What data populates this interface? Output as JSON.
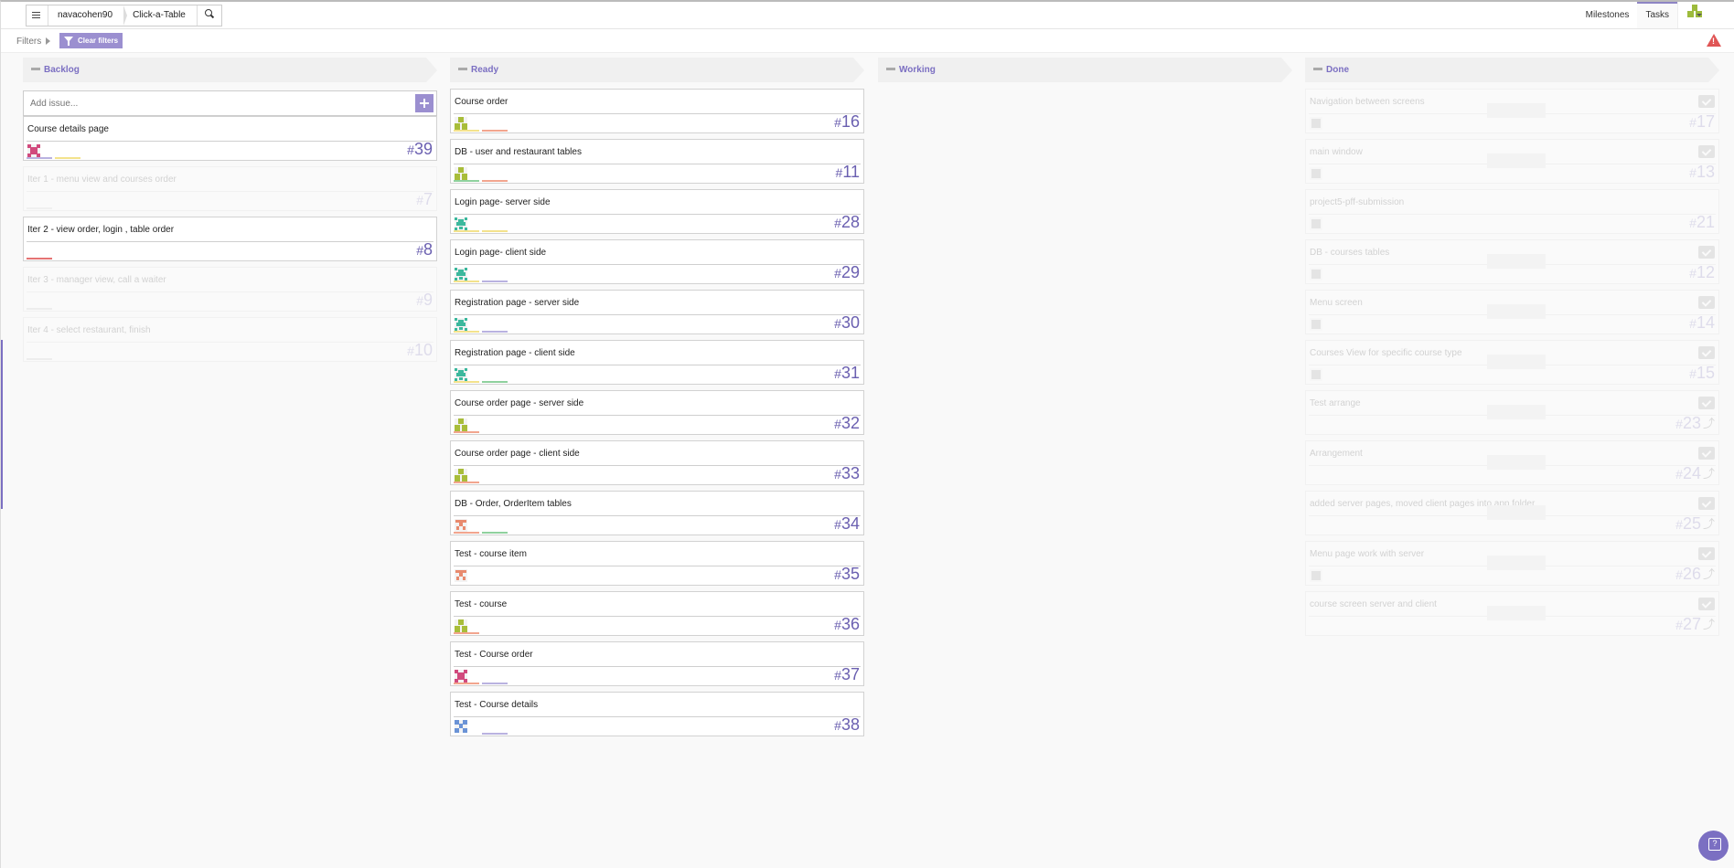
{
  "breadcrumb": {
    "owner": "navacohen90",
    "repo": "Click-a-Table"
  },
  "topnav": {
    "milestones": "Milestones",
    "tasks": "Tasks"
  },
  "filters": {
    "label": "Filters",
    "clear": "Clear filters"
  },
  "colors": {
    "accent": "#7b6fc2",
    "button": "#9b8fd0",
    "warning": "#e05555"
  },
  "columns": [
    {
      "title": "Backlog",
      "add_issue_placeholder": "Add issue...",
      "cards": [
        {
          "title": "Course details page",
          "hash": "#",
          "number": "39",
          "faded": false,
          "avatar": "pink",
          "bars": [
            "#b9b2e0",
            "#f3e28c"
          ]
        },
        {
          "title": "Iter 1 - menu view and courses order",
          "hash": "#",
          "number": "7",
          "faded": true,
          "avatar": "",
          "bars": [
            "#cccccc"
          ]
        },
        {
          "title": "Iter 2 - view order, login , table order",
          "hash": "#",
          "number": "8",
          "faded": false,
          "avatar": "",
          "bars": [
            "#e57373"
          ]
        },
        {
          "title": "Iter 3 - manager view, call a waiter",
          "hash": "#",
          "number": "9",
          "faded": true,
          "avatar": "",
          "bars": [
            "#bbbbbb"
          ]
        },
        {
          "title": "Iter 4 - select restaurant, finish",
          "hash": "#",
          "number": "10",
          "faded": true,
          "avatar": "",
          "bars": [
            "#bbbbbb"
          ]
        }
      ]
    },
    {
      "title": "Ready",
      "cards": [
        {
          "title": "Course order",
          "hash": "#",
          "number": "16",
          "faded": false,
          "avatar": "olive",
          "bars": [
            "#f3e28c",
            "#f2a58e"
          ]
        },
        {
          "title": "DB - user and restaurant tables",
          "hash": "#",
          "number": "11",
          "faded": false,
          "avatar": "olive",
          "bars": [
            "#8fd19e",
            "#f2a58e"
          ]
        },
        {
          "title": "Login page- server side",
          "hash": "#",
          "number": "28",
          "faded": false,
          "avatar": "teal",
          "bars": [
            "#f3e28c",
            "#f3e28c"
          ]
        },
        {
          "title": "Login page- client side",
          "hash": "#",
          "number": "29",
          "faded": false,
          "avatar": "teal",
          "bars": [
            "#f3e28c",
            "#b9b2e0"
          ]
        },
        {
          "title": "Registration page - server side",
          "hash": "#",
          "number": "30",
          "faded": false,
          "avatar": "teal",
          "bars": [
            "#f3e28c",
            "#b9b2e0"
          ]
        },
        {
          "title": "Registration page - client side",
          "hash": "#",
          "number": "31",
          "faded": false,
          "avatar": "teal",
          "bars": [
            "#f3e28c",
            "#8fd19e"
          ]
        },
        {
          "title": "Course order page - server side",
          "hash": "#",
          "number": "32",
          "faded": false,
          "avatar": "olive",
          "bars": [
            "#f2a58e"
          ]
        },
        {
          "title": "Course order page - client side",
          "hash": "#",
          "number": "33",
          "faded": false,
          "avatar": "olive",
          "bars": [
            "#f2a58e"
          ]
        },
        {
          "title": "DB - Order, OrderItem tables",
          "hash": "#",
          "number": "34",
          "faded": false,
          "avatar": "salmon",
          "bars": [
            "#f2a58e",
            "#8fd19e"
          ]
        },
        {
          "title": "Test - course item",
          "hash": "#",
          "number": "35",
          "faded": false,
          "avatar": "salmon",
          "bars": []
        },
        {
          "title": "Test - course",
          "hash": "#",
          "number": "36",
          "faded": false,
          "avatar": "olive",
          "bars": [
            "#f2a58e"
          ]
        },
        {
          "title": "Test - Course order",
          "hash": "#",
          "number": "37",
          "faded": false,
          "avatar": "pink",
          "bars": [
            "#f2a58e",
            "#b9b2e0"
          ]
        },
        {
          "title": "Test - Course details",
          "hash": "#",
          "number": "38",
          "faded": false,
          "avatar": "blue",
          "bars": [
            "#ffffff",
            "#b9b2e0"
          ]
        }
      ]
    },
    {
      "title": "Working",
      "cards": []
    },
    {
      "title": "Done",
      "cards": [
        {
          "title": "Navigation between screens",
          "hash": "#",
          "number": "17",
          "faded": true,
          "avatar": "gray",
          "bars": [],
          "check": true,
          "pr": false
        },
        {
          "title": "main window",
          "hash": "#",
          "number": "13",
          "faded": true,
          "avatar": "gray",
          "bars": [],
          "check": true,
          "pr": false
        },
        {
          "title": "project5-pff-submission",
          "hash": "#",
          "number": "21",
          "faded": true,
          "avatar": "gray",
          "bars": [],
          "check": false,
          "pr": false
        },
        {
          "title": "DB - courses tables",
          "hash": "#",
          "number": "12",
          "faded": true,
          "avatar": "gray",
          "bars": [],
          "check": true,
          "pr": false
        },
        {
          "title": "Menu screen",
          "hash": "#",
          "number": "14",
          "faded": true,
          "avatar": "gray",
          "bars": [],
          "check": true,
          "pr": false
        },
        {
          "title": "Courses View for specific course type",
          "hash": "#",
          "number": "15",
          "faded": true,
          "avatar": "gray",
          "bars": [],
          "check": true,
          "pr": false
        },
        {
          "title": "Test arrange",
          "hash": "#",
          "number": "23",
          "faded": true,
          "avatar": "",
          "bars": [],
          "check": true,
          "pr": true
        },
        {
          "title": "Arrangement",
          "hash": "#",
          "number": "24",
          "faded": true,
          "avatar": "",
          "bars": [],
          "check": true,
          "pr": true
        },
        {
          "title": "added server pages, moved client pages into app folder",
          "hash": "#",
          "number": "25",
          "faded": true,
          "avatar": "",
          "bars": [],
          "check": true,
          "pr": true
        },
        {
          "title": "Menu page work with server",
          "hash": "#",
          "number": "26",
          "faded": true,
          "avatar": "gray",
          "bars": [],
          "check": true,
          "pr": true
        },
        {
          "title": "course screen server and client",
          "hash": "#",
          "number": "27",
          "faded": true,
          "avatar": "",
          "bars": [],
          "check": true,
          "pr": true
        }
      ]
    }
  ]
}
